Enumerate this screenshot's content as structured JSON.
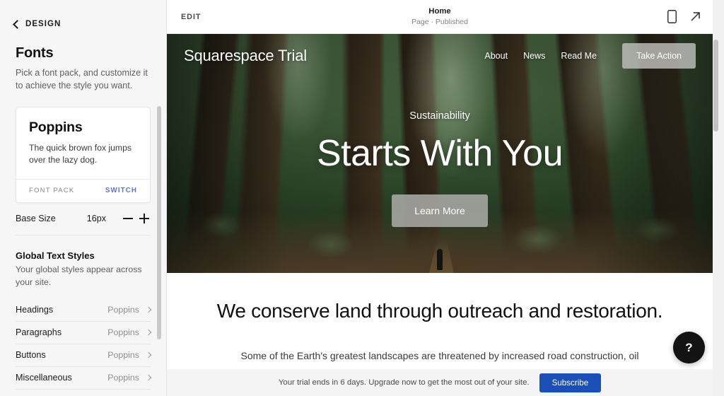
{
  "sidebar": {
    "back_label": "DESIGN",
    "back_icon": "chevron-left-icon",
    "title": "Fonts",
    "subtitle": "Pick a font pack, and customize it to achieve the style you want.",
    "font_pack": {
      "name": "Poppins",
      "sample": "The quick brown fox jumps over the lazy dog.",
      "footer_label": "FONT PACK",
      "switch_label": "SWITCH",
      "switch_color": "#5b77d6"
    },
    "base_size": {
      "label": "Base Size",
      "value": "16px",
      "decrease_icon": "minus-icon",
      "increase_icon": "plus-icon"
    },
    "global_styles": {
      "title": "Global Text Styles",
      "subtitle": "Your global styles appear across your site.",
      "rows": [
        {
          "name": "Headings",
          "value": "Poppins",
          "chevron": "chevron-right-icon"
        },
        {
          "name": "Paragraphs",
          "value": "Poppins",
          "chevron": "chevron-right-icon"
        },
        {
          "name": "Buttons",
          "value": "Poppins",
          "chevron": "chevron-right-icon"
        },
        {
          "name": "Miscellaneous",
          "value": "Poppins",
          "chevron": "chevron-right-icon"
        }
      ]
    }
  },
  "preview_toolbar": {
    "edit_label": "EDIT",
    "page_name": "Home",
    "page_status": "Page · Published",
    "mobile_icon": "mobile-device-icon",
    "open_icon": "arrow-up-right-icon"
  },
  "site": {
    "logo": "Squarespace Trial",
    "nav_links": [
      "About",
      "News",
      "Read Me"
    ],
    "cta_label": "Take Action",
    "hero": {
      "eyebrow": "Sustainability",
      "title": "Starts With You",
      "button_label": "Learn More",
      "selection_color": "#4da3e8"
    },
    "section": {
      "heading": "We conserve land through outreach and restoration.",
      "body": "Some of the Earth's greatest landscapes are threatened by increased road construction, oil"
    }
  },
  "help": {
    "label": "?",
    "icon": "question-mark-icon"
  },
  "trial_bar": {
    "message": "Your trial ends in 6 days. Upgrade now to get the most out of your site.",
    "button_label": "Subscribe",
    "button_color": "#1c4fb5"
  }
}
